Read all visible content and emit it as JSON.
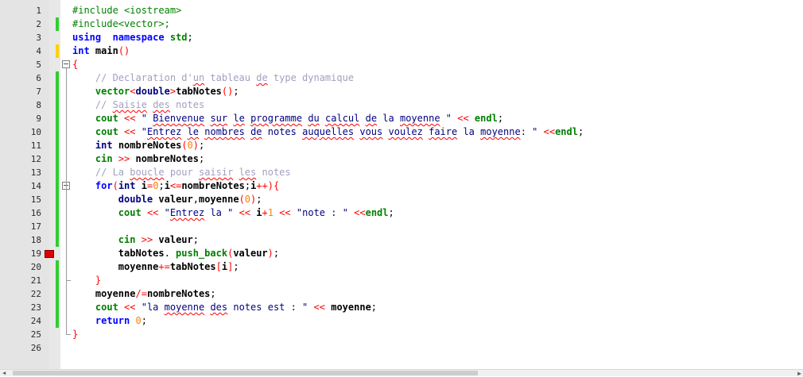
{
  "editor": {
    "language": "cpp",
    "colors": {
      "gutter_bg": "#e4e4e4",
      "change_marker": "#32cd32",
      "unsaved_marker": "#ffd000",
      "breakpoint": "#e00000",
      "keyword": "#0000ff",
      "type": "#000080",
      "preprocessor": "#008000",
      "string": "#000080",
      "comment": "#a0a0c0",
      "number": "#ff8000",
      "operator": "#ff0000"
    },
    "lines": [
      {
        "n": "1",
        "tokens": [
          [
            "pre",
            "#include <iostream>"
          ]
        ]
      },
      {
        "n": "2",
        "marker": "saved",
        "tokens": [
          [
            "pre",
            "#include<vector>;"
          ]
        ]
      },
      {
        "n": "3",
        "tokens": [
          [
            "kw",
            "using"
          ],
          [
            "",
            "  "
          ],
          [
            "kw",
            "namespace"
          ],
          [
            "",
            " "
          ],
          [
            "std",
            "std"
          ],
          [
            "",
            ";"
          ]
        ]
      },
      {
        "n": "4",
        "marker": "unsaved",
        "tokens": [
          [
            "kw",
            "int"
          ],
          [
            "",
            " "
          ],
          [
            "id",
            "main"
          ],
          [
            "op",
            "()"
          ]
        ]
      },
      {
        "n": "5",
        "fold": "open",
        "tokens": [
          [
            "op",
            "{"
          ]
        ]
      },
      {
        "n": "6",
        "marker": "saved",
        "tokens": [
          [
            "",
            "    "
          ],
          [
            "cmt",
            "// Declaration d'"
          ],
          [
            "cmt sq",
            "un"
          ],
          [
            "cmt",
            " tableau "
          ],
          [
            "cmt sq",
            "de"
          ],
          [
            "cmt",
            " type dynamique"
          ]
        ]
      },
      {
        "n": "7",
        "marker": "saved",
        "tokens": [
          [
            "",
            "    "
          ],
          [
            "std",
            "vector"
          ],
          [
            "op",
            "<"
          ],
          [
            "kt",
            "double"
          ],
          [
            "op",
            ">"
          ],
          [
            "id",
            "tabNotes"
          ],
          [
            "op",
            "()"
          ],
          [
            "",
            ";"
          ]
        ]
      },
      {
        "n": "8",
        "marker": "saved",
        "tokens": [
          [
            "",
            "    "
          ],
          [
            "cmt",
            "// "
          ],
          [
            "cmt sq",
            "Saisie"
          ],
          [
            "cmt",
            " "
          ],
          [
            "cmt sq",
            "des"
          ],
          [
            "cmt",
            " notes"
          ]
        ]
      },
      {
        "n": "9",
        "marker": "saved",
        "tokens": [
          [
            "",
            "    "
          ],
          [
            "std",
            "cout"
          ],
          [
            "",
            " "
          ],
          [
            "op",
            "<<"
          ],
          [
            "",
            " "
          ],
          [
            "str",
            "\" "
          ],
          [
            "str sq",
            "Bienvenue"
          ],
          [
            "str",
            " "
          ],
          [
            "str sq",
            "sur"
          ],
          [
            "str",
            " "
          ],
          [
            "str sq",
            "le"
          ],
          [
            "str",
            " "
          ],
          [
            "str sq",
            "programme"
          ],
          [
            "str",
            " "
          ],
          [
            "str sq",
            "du"
          ],
          [
            "str",
            " "
          ],
          [
            "str sq",
            "calcul"
          ],
          [
            "str",
            " "
          ],
          [
            "str sq",
            "de"
          ],
          [
            "str",
            " la "
          ],
          [
            "str sq",
            "moyenne"
          ],
          [
            "str",
            " \""
          ],
          [
            "",
            " "
          ],
          [
            "op",
            "<<"
          ],
          [
            "",
            " "
          ],
          [
            "std",
            "endl"
          ],
          [
            "",
            ";"
          ]
        ]
      },
      {
        "n": "10",
        "marker": "saved",
        "tokens": [
          [
            "",
            "    "
          ],
          [
            "std",
            "cout"
          ],
          [
            "",
            " "
          ],
          [
            "op",
            "<<"
          ],
          [
            "",
            " "
          ],
          [
            "str",
            "\""
          ],
          [
            "str sq",
            "Entrez"
          ],
          [
            "str",
            " "
          ],
          [
            "str sq",
            "le"
          ],
          [
            "str",
            " "
          ],
          [
            "str sq",
            "nombres"
          ],
          [
            "str",
            " "
          ],
          [
            "str sq",
            "de"
          ],
          [
            "str",
            " notes "
          ],
          [
            "str sq",
            "auquelles"
          ],
          [
            "str",
            " "
          ],
          [
            "str sq",
            "vous"
          ],
          [
            "str",
            " "
          ],
          [
            "str sq",
            "voulez"
          ],
          [
            "str",
            " "
          ],
          [
            "str sq",
            "faire"
          ],
          [
            "str",
            " la "
          ],
          [
            "str sq",
            "moyenne"
          ],
          [
            "str",
            ": \""
          ],
          [
            "",
            " "
          ],
          [
            "op",
            "<<"
          ],
          [
            "std",
            "endl"
          ],
          [
            "",
            ";"
          ]
        ]
      },
      {
        "n": "11",
        "marker": "saved",
        "tokens": [
          [
            "",
            "    "
          ],
          [
            "kt",
            "int"
          ],
          [
            "",
            " "
          ],
          [
            "id",
            "nombreNotes"
          ],
          [
            "op",
            "("
          ],
          [
            "num",
            "0"
          ],
          [
            "op",
            ")"
          ],
          [
            "",
            ";"
          ]
        ]
      },
      {
        "n": "12",
        "marker": "saved",
        "tokens": [
          [
            "",
            "    "
          ],
          [
            "std",
            "cin"
          ],
          [
            "",
            " "
          ],
          [
            "op",
            ">>"
          ],
          [
            "",
            " "
          ],
          [
            "id",
            "nombreNotes"
          ],
          [
            "",
            ";"
          ]
        ]
      },
      {
        "n": "13",
        "marker": "saved",
        "tokens": [
          [
            "",
            "    "
          ],
          [
            "cmt",
            "// La "
          ],
          [
            "cmt sq",
            "boucle"
          ],
          [
            "cmt",
            " pour "
          ],
          [
            "cmt sq",
            "saisir"
          ],
          [
            "cmt",
            " "
          ],
          [
            "cmt sq",
            "les"
          ],
          [
            "cmt",
            " notes"
          ]
        ]
      },
      {
        "n": "14",
        "marker": "saved",
        "fold": "open",
        "tokens": [
          [
            "",
            "    "
          ],
          [
            "kw",
            "for"
          ],
          [
            "op",
            "("
          ],
          [
            "kt",
            "int"
          ],
          [
            "",
            " "
          ],
          [
            "id",
            "i"
          ],
          [
            "op",
            "="
          ],
          [
            "num",
            "0"
          ],
          [
            "",
            ";"
          ],
          [
            "id",
            "i"
          ],
          [
            "op",
            "<="
          ],
          [
            "id",
            "nombreNotes"
          ],
          [
            "",
            ";"
          ],
          [
            "id",
            "i"
          ],
          [
            "op",
            "++){"
          ]
        ]
      },
      {
        "n": "15",
        "marker": "saved",
        "tokens": [
          [
            "",
            "        "
          ],
          [
            "kt",
            "double"
          ],
          [
            "",
            " "
          ],
          [
            "id",
            "valeur"
          ],
          [
            "",
            ","
          ],
          [
            "id",
            "moyenne"
          ],
          [
            "op",
            "("
          ],
          [
            "num",
            "0"
          ],
          [
            "op",
            ")"
          ],
          [
            "",
            ";"
          ]
        ]
      },
      {
        "n": "16",
        "marker": "saved",
        "tokens": [
          [
            "",
            "        "
          ],
          [
            "std",
            "cout"
          ],
          [
            "",
            " "
          ],
          [
            "op",
            "<<"
          ],
          [
            "",
            " "
          ],
          [
            "str",
            "\""
          ],
          [
            "str sq",
            "Entrez"
          ],
          [
            "str",
            " la \""
          ],
          [
            "",
            " "
          ],
          [
            "op",
            "<<"
          ],
          [
            "",
            " "
          ],
          [
            "id",
            "i"
          ],
          [
            "op",
            "+"
          ],
          [
            "num",
            "1"
          ],
          [
            "",
            " "
          ],
          [
            "op",
            "<<"
          ],
          [
            "",
            " "
          ],
          [
            "str",
            "\"note : \""
          ],
          [
            "",
            " "
          ],
          [
            "op",
            "<<"
          ],
          [
            "std",
            "endl"
          ],
          [
            "",
            ";"
          ]
        ]
      },
      {
        "n": "17",
        "marker": "saved",
        "tokens": []
      },
      {
        "n": "18",
        "marker": "saved",
        "tokens": [
          [
            "",
            "        "
          ],
          [
            "std",
            "cin"
          ],
          [
            "",
            " "
          ],
          [
            "op",
            ">>"
          ],
          [
            "",
            " "
          ],
          [
            "id",
            "valeur"
          ],
          [
            "",
            ";"
          ]
        ]
      },
      {
        "n": "19",
        "marker": "breakpoint",
        "tokens": [
          [
            "",
            "        "
          ],
          [
            "id",
            "tabNotes"
          ],
          [
            "",
            ". "
          ],
          [
            "std",
            "push_back"
          ],
          [
            "op",
            "("
          ],
          [
            "id",
            "valeur"
          ],
          [
            "op",
            ")"
          ],
          [
            "",
            ";"
          ]
        ]
      },
      {
        "n": "20",
        "marker": "saved",
        "tokens": [
          [
            "",
            "        "
          ],
          [
            "id",
            "moyenne"
          ],
          [
            "op",
            "+="
          ],
          [
            "id",
            "tabNotes"
          ],
          [
            "op",
            "["
          ],
          [
            "id",
            "i"
          ],
          [
            "op",
            "]"
          ],
          [
            "",
            ";"
          ]
        ]
      },
      {
        "n": "21",
        "marker": "saved",
        "fold": "end",
        "tokens": [
          [
            "",
            "    "
          ],
          [
            "op",
            "}"
          ]
        ]
      },
      {
        "n": "22",
        "marker": "saved",
        "tokens": [
          [
            "",
            "    "
          ],
          [
            "id",
            "moyenne"
          ],
          [
            "op",
            "/="
          ],
          [
            "id",
            "nombreNotes"
          ],
          [
            "",
            ";"
          ]
        ]
      },
      {
        "n": "23",
        "marker": "saved",
        "tokens": [
          [
            "",
            "    "
          ],
          [
            "std",
            "cout"
          ],
          [
            "",
            " "
          ],
          [
            "op",
            "<<"
          ],
          [
            "",
            " "
          ],
          [
            "str",
            "\"la "
          ],
          [
            "str sq",
            "moyenne"
          ],
          [
            "str",
            " "
          ],
          [
            "str sq",
            "des"
          ],
          [
            "str",
            " notes est : \""
          ],
          [
            "",
            " "
          ],
          [
            "op",
            "<<"
          ],
          [
            "",
            " "
          ],
          [
            "id",
            "moyenne"
          ],
          [
            "",
            ";"
          ]
        ]
      },
      {
        "n": "24",
        "marker": "saved",
        "tokens": [
          [
            "",
            "    "
          ],
          [
            "kw",
            "return"
          ],
          [
            "",
            " "
          ],
          [
            "num",
            "0"
          ],
          [
            "",
            ";"
          ]
        ]
      },
      {
        "n": "25",
        "fold": "end",
        "tokens": [
          [
            "op",
            "}"
          ]
        ]
      },
      {
        "n": "26",
        "tokens": []
      }
    ]
  },
  "scrollbar": {
    "left_arrow_icon": "chevron-left-icon",
    "right_arrow_icon": "chevron-right-icon"
  }
}
